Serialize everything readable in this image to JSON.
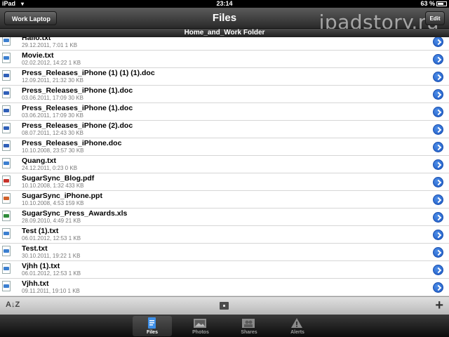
{
  "status_bar": {
    "device": "iPad",
    "time": "23:14",
    "battery": "63 %"
  },
  "nav": {
    "back_label": "Work Laptop",
    "title": "Files",
    "edit_label": "Edit",
    "watermark": "ipadstory.ru"
  },
  "folder": {
    "name": "Home_and_Work Folder"
  },
  "files": [
    {
      "name": "Hallo.txt",
      "meta": "29.12.2011, 7:01 1 KB",
      "type": "txt"
    },
    {
      "name": "Movie.txt",
      "meta": "02.02.2012, 14:22 1 KB",
      "type": "txt"
    },
    {
      "name": "Press_Releases_iPhone (1) (1) (1).doc",
      "meta": "12.09.2011, 21:32 30 KB",
      "type": "doc"
    },
    {
      "name": "Press_Releases_iPhone (1).doc",
      "meta": "03.06.2011, 17:09 30 KB",
      "type": "doc"
    },
    {
      "name": "Press_Releases_iPhone (1).doc",
      "meta": "03.06.2011, 17:09 30 KB",
      "type": "doc"
    },
    {
      "name": "Press_Releases_iPhone (2).doc",
      "meta": "08.07.2011, 12:43 30 KB",
      "type": "doc"
    },
    {
      "name": "Press_Releases_iPhone.doc",
      "meta": "10.10.2008, 23:57 30 KB",
      "type": "doc"
    },
    {
      "name": "Quang.txt",
      "meta": "24.12.2011, 0:23 0 KB",
      "type": "txt"
    },
    {
      "name": "SugarSync_Blog.pdf",
      "meta": "10.10.2008, 1:32 433 KB",
      "type": "pdf"
    },
    {
      "name": "SugarSync_iPhone.ppt",
      "meta": "10.10.2008, 4:53 159 KB",
      "type": "ppt"
    },
    {
      "name": "SugarSync_Press_Awards.xls",
      "meta": "28.09.2010, 4:49 21 KB",
      "type": "xls"
    },
    {
      "name": "Test (1).txt",
      "meta": "06.01.2012, 12:53 1 KB",
      "type": "txt"
    },
    {
      "name": "Test.txt",
      "meta": "30.10.2011, 19:22 1 KB",
      "type": "txt"
    },
    {
      "name": "Vjhh (1).txt",
      "meta": "06.01.2012, 12:53 1 KB",
      "type": "txt"
    },
    {
      "name": "Vjhh.txt",
      "meta": "09.11.2011, 19:10 1 KB",
      "type": "txt"
    }
  ],
  "file_type_colors": {
    "txt": "#3b7fd0",
    "doc": "#2f5fb8",
    "pdf": "#c8332b",
    "ppt": "#d0602a",
    "xls": "#2e8b3a"
  },
  "toolbar": {
    "sort_label": "A↓Z",
    "add_label": "+"
  },
  "tabs": [
    {
      "label": "Files",
      "icon": "document-icon",
      "active": true
    },
    {
      "label": "Photos",
      "icon": "photo-icon",
      "active": false
    },
    {
      "label": "Shares",
      "icon": "shares-icon",
      "active": false
    },
    {
      "label": "Alerts",
      "icon": "alert-icon",
      "active": false
    }
  ],
  "colors": {
    "accent": "#1c58c4",
    "nav_bg": "#3a3a3a"
  }
}
